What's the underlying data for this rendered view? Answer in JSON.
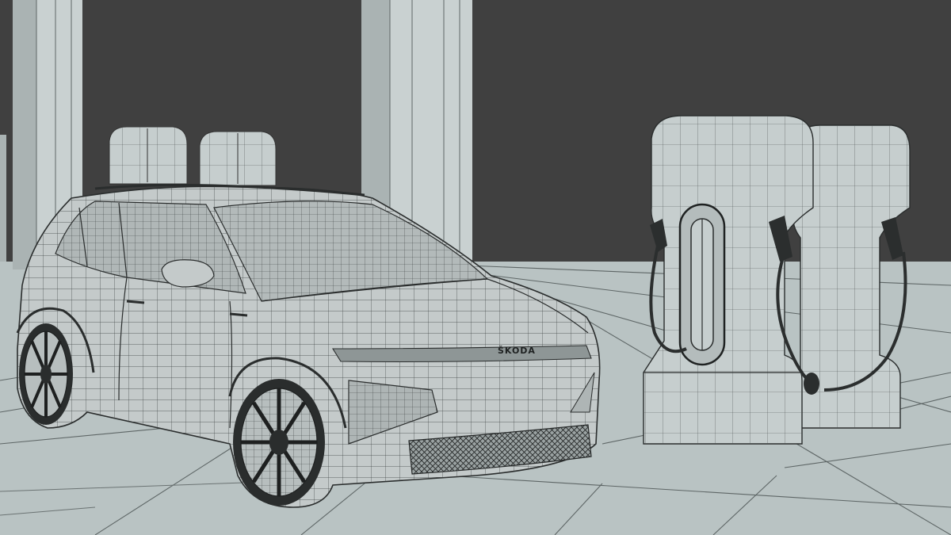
{
  "scene": {
    "logo_text": "ŠKODA"
  },
  "colors": {
    "background": "#3b3b3b",
    "wall": "#404040",
    "floor": "#b9c3c3",
    "floor_line": "#5e6666",
    "pillar": "#c9d1d1",
    "pillar_shade": "#aab3b3",
    "car_body": "#c4caca",
    "car_dark": "#2a2d2d",
    "mesh_line": "#3c4141",
    "charger": "#c6cece",
    "cable": "#2b2e2e"
  },
  "icons": {
    "car": "car-wireframe",
    "charger": "ev-charger-wireframe"
  }
}
